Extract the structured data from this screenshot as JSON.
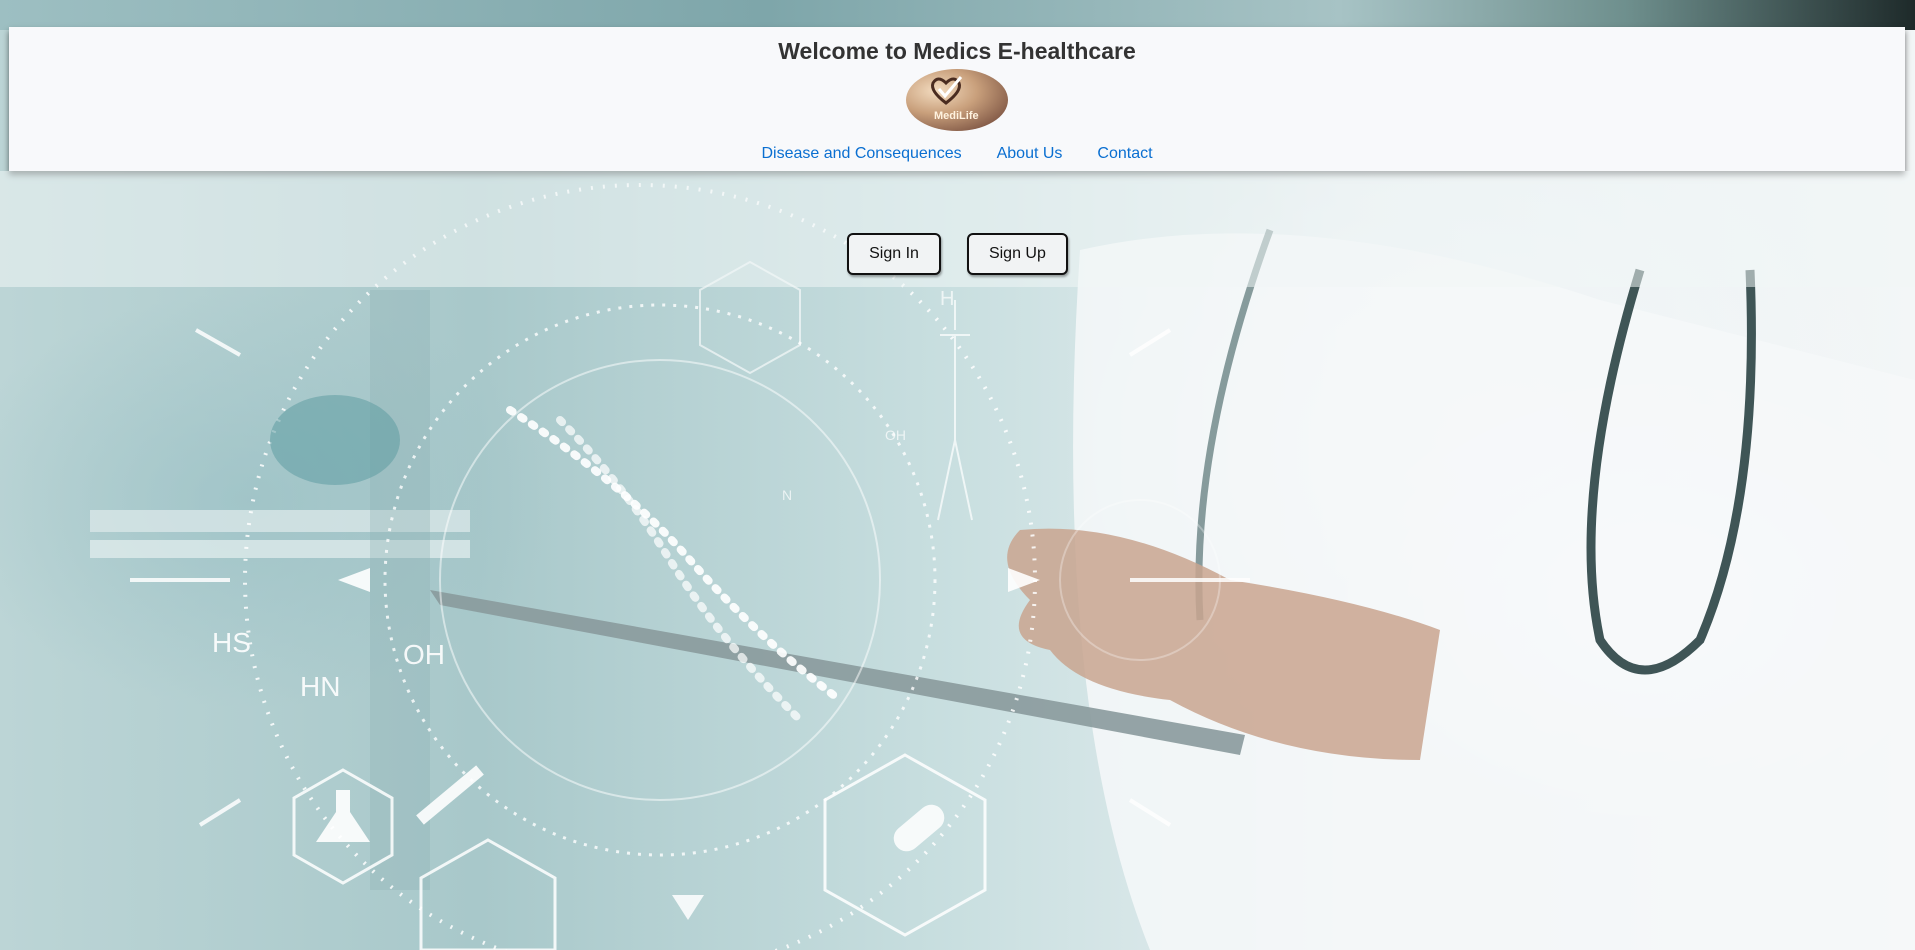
{
  "header": {
    "title": "Welcome to Medics E-healthcare",
    "logo_text": "MediLife"
  },
  "nav": {
    "items": [
      {
        "label": "Disease and Consequences"
      },
      {
        "label": "About Us"
      },
      {
        "label": "Contact"
      }
    ]
  },
  "auth": {
    "sign_in_label": "Sign In",
    "sign_up_label": "Sign Up"
  },
  "hero": {
    "overlay_labels": [
      "HS",
      "HN",
      "OH",
      "OH",
      "N",
      "H"
    ]
  },
  "colors": {
    "link": "#0a6fd1",
    "header_bg": "#f8f9fb",
    "title": "#333333"
  }
}
